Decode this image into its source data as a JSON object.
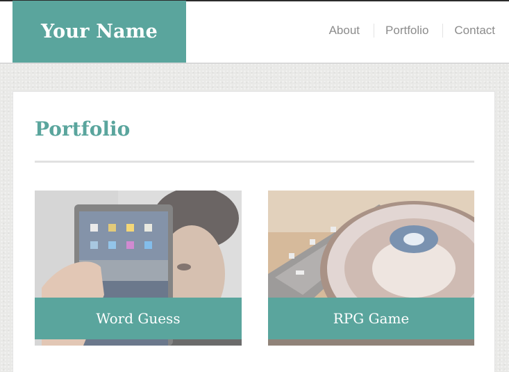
{
  "header": {
    "brand": "Your Name",
    "nav": [
      "About",
      "Portfolio",
      "Contact"
    ]
  },
  "main": {
    "title": "Portfolio",
    "projects": [
      {
        "title": "Word Guess",
        "image": "person-holding-tablet"
      },
      {
        "title": "RPG Game",
        "image": "dj-turntable"
      }
    ]
  },
  "colors": {
    "accent": "#5aa59d",
    "nav_text": "#8c8c8c",
    "background": "#e9e9e7"
  }
}
